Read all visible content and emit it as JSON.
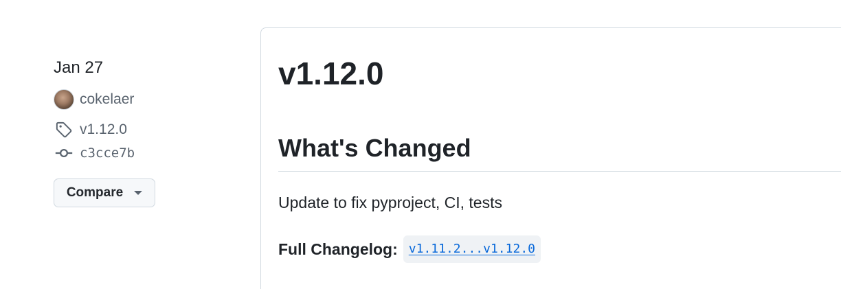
{
  "sidebar": {
    "date": "Jan 27",
    "author": "cokelaer",
    "tag": "v1.12.0",
    "commit": "c3cce7b",
    "compare_label": "Compare"
  },
  "release": {
    "title": "v1.12.0",
    "section_heading": "What's Changed",
    "summary": "Update to fix pyproject, CI, tests",
    "changelog_label": "Full Changelog:",
    "changelog_link": "v1.11.2...v1.12.0"
  },
  "icons": {
    "tag": "tag-icon",
    "commit": "git-commit-icon",
    "dropdown": "triangle-down-icon"
  },
  "colors": {
    "link": "#0969da",
    "text": "#1f2328",
    "muted": "#59636e",
    "border": "#d1d9e0"
  }
}
